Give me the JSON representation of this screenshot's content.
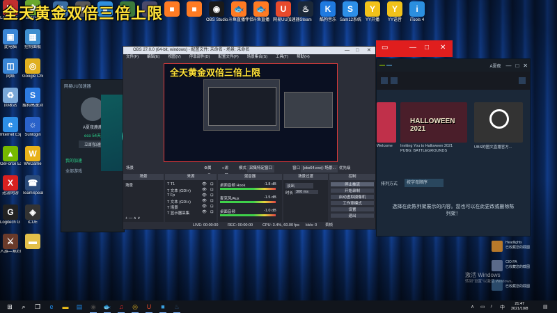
{
  "overlay_title": "全天黄金双倍三倍上限",
  "top_shortcuts": [
    {
      "label": "",
      "icon": "gear-icon",
      "color": "#3a6ea5"
    },
    {
      "label": "",
      "icon": "app-icon",
      "color": "#5a5a5a"
    },
    {
      "label": "",
      "icon": "app-icon",
      "color": "#2f8fdf"
    },
    {
      "label": "",
      "icon": "app-icon",
      "color": "#3b7a3b"
    },
    {
      "label": "",
      "icon": "app-icon",
      "color": "#4a4a6a"
    },
    {
      "label": "",
      "icon": "app-icon",
      "color": "#ff7b23"
    },
    {
      "label": "",
      "icon": "app-icon",
      "color": "#ff7b23"
    },
    {
      "label": "OBS Studio",
      "icon": "obs-icon",
      "color": "#1a1a1a"
    },
    {
      "label": "斗鱼直播伴侣",
      "icon": "douyu-icon",
      "color": "#ff7b23"
    },
    {
      "label": "斗鱼直播",
      "icon": "douyu-icon",
      "color": "#ff7b23"
    },
    {
      "label": "网易UU加速器",
      "icon": "uu-icon",
      "color": "#e84a2c"
    },
    {
      "label": "Steam",
      "icon": "steam-icon",
      "color": "#1b2838"
    },
    {
      "label": "酷狗音乐",
      "icon": "kugou-icon",
      "color": "#1f7ae0"
    },
    {
      "label": "Sam12系统",
      "icon": "s-icon",
      "color": "#2d8fe8"
    },
    {
      "label": "YY开播",
      "icon": "yy-icon",
      "color": "#f2c21a"
    },
    {
      "label": "YY语音",
      "icon": "yy-icon",
      "color": "#f2c21a"
    },
    {
      "label": "iTools 4",
      "icon": "itools-icon",
      "color": "#2b8fe0"
    }
  ],
  "desktop_icons": [
    {
      "label": "Launcher...",
      "icon": "launcher-icon",
      "color": "#c12f2f"
    },
    {
      "label": "PlantsVs...",
      "icon": "plants-icon",
      "color": "#6aa82e"
    },
    {
      "label": "此电脑",
      "icon": "computer-icon",
      "color": "#3a86d6"
    },
    {
      "label": "控制面板",
      "icon": "control-panel-icon",
      "color": "#3f8fcf"
    },
    {
      "label": "网络",
      "icon": "network-icon",
      "color": "#3a86d6"
    },
    {
      "label": "Google Chrome",
      "icon": "chrome-icon",
      "color": "#e0b020"
    },
    {
      "label": "回收站",
      "icon": "recycle-bin-icon",
      "color": "#7aa8d8"
    },
    {
      "label": "搜狗高速浏览器",
      "icon": "sogou-icon",
      "color": "#2d7be0"
    },
    {
      "label": "Internet Explorer",
      "icon": "ie-icon",
      "color": "#2d8fe8"
    },
    {
      "label": "Sunlogin",
      "icon": "sunlogin-icon",
      "color": "#2a62c9"
    },
    {
      "label": "GeForce Experience",
      "icon": "geforce-icon",
      "color": "#76b900"
    },
    {
      "label": "WeGame",
      "icon": "wegame-icon",
      "color": "#e8b21a"
    },
    {
      "label": "迅游网游",
      "icon": "xunyou-icon",
      "color": "#d82020"
    },
    {
      "label": "TeamSpeak",
      "icon": "teamspeak-icon",
      "color": "#2a4a7a"
    },
    {
      "label": "Logitech G HUB",
      "icon": "logitech-icon",
      "color": "#222222"
    },
    {
      "label": "iCUE",
      "icon": "icue-icon",
      "color": "#333333"
    },
    {
      "label": "人族—焦灼的Human Fa...",
      "icon": "game-icon",
      "color": "#6a3a2a"
    },
    {
      "label": "",
      "icon": "folder-icon",
      "color": "#e3c04a"
    }
  ],
  "obs": {
    "title": "OBS 27.0.0 (64-bit, windows) - 配置文件: 未命名 - 场景: 未命名",
    "menu": [
      "文件(F)",
      "编辑(E)",
      "视图(V)",
      "停靠部件(D)",
      "配置文件(P)",
      "场景集合(S)",
      "工具(T)",
      "帮助(H)"
    ],
    "preview_title": "全天黄金双倍三倍上限",
    "toolbar": {
      "scene_label": "场景",
      "props": "属性",
      "filters": "滤镜",
      "mode_label": "模式",
      "mode_value": "采集特定窗口",
      "window_label": "窗口",
      "window_value": "[obs64.exe]: 场景...",
      "priority": "优先级"
    },
    "docks": {
      "scenes": "场景",
      "sources": "来源",
      "mixer": "混音器",
      "transitions": "场景过渡",
      "controls": "控制"
    },
    "scenes": [
      "场景"
    ],
    "sources": [
      "T1",
      "文本 (GDI+)",
      "Fp",
      "文本 (GDI+)",
      "场景",
      "显示器采集"
    ],
    "mixer": [
      {
        "name": "桌面音频 Hook",
        "level": "-1.8 dB"
      },
      {
        "name": "麦克风/Aux",
        "level": "-1.5 dB"
      },
      {
        "name": "桌面音频",
        "level": "-1.0 dB"
      }
    ],
    "transition": {
      "type": "淡出",
      "duration_label": "时长",
      "duration_value": "300 ms"
    },
    "controls": [
      "停止推流",
      "开始录制",
      "启动虚拟摄像机",
      "工作室模式",
      "设置",
      "退出"
    ],
    "status": {
      "live": "LIVE: 00:00:00",
      "rec": "REC: 00:00:00",
      "cpu": "CPU: 3.4%, 60.00 fps",
      "kbps": "kb/s: 0",
      "drop": "丢帧"
    }
  },
  "steam": {
    "user": "A夏夜",
    "shelf": [
      {
        "caption": "Welcome",
        "color": "#c0304a"
      },
      {
        "caption": "Inviting You to Halloween 2021",
        "color": "#4a1e2a",
        "headline": "HALLOWEEN 2021"
      },
      {
        "caption": "PUBG: BATTLEGROUNDS",
        "color": "#333"
      },
      {
        "caption": "UBS的图文直播官方...",
        "color": "#5a6a7a"
      }
    ],
    "sort_label": "排列方式",
    "sort_value": "按字母顺序",
    "empty_text": "选择在此陈列架展示的内容。您也可以在此更改或删除陈列架！"
  },
  "left_panel": {
    "title": "网易UU加速器",
    "username": "A夏夜鹿鹿",
    "menu": [
      "我的加速",
      "全部游戏"
    ],
    "speed": "eco 54天",
    "version": "立即加速"
  },
  "notifications": [
    {
      "name": "Headlights",
      "text": "已收藏您的截图",
      "color": "#b8792a"
    },
    {
      "name": "CIO PA",
      "text": "已收藏您的截图",
      "color": "#5a6a8a"
    },
    {
      "name": "",
      "text": "已收藏您的截图",
      "color": "#2a4a6a"
    }
  ],
  "activate": {
    "line1": "激活 Windows",
    "line2": "转到\"设置\"以激活 Windows。"
  },
  "taskbar": {
    "clock_time": "21:47",
    "clock_date": "2021/10/8",
    "items": [
      {
        "icon": "windows-start-icon",
        "color": "#ffffff"
      },
      {
        "icon": "search-icon",
        "color": "#ffffff"
      },
      {
        "icon": "task-view-icon",
        "color": "#ffffff"
      },
      {
        "icon": "edge-icon",
        "color": "#1e88e5"
      },
      {
        "icon": "explorer-icon",
        "color": "#f2c21a"
      },
      {
        "icon": "store-icon",
        "color": "#1e88e5"
      },
      {
        "icon": "obs-icon",
        "color": "#444444"
      },
      {
        "icon": "douyu-icon",
        "color": "#ff7b23"
      },
      {
        "icon": "netease-music-icon",
        "color": "#e22a2a"
      },
      {
        "icon": "chrome-icon",
        "color": "#e0b020"
      },
      {
        "icon": "uu-icon",
        "color": "#e84a2c"
      },
      {
        "icon": "app-icon",
        "color": "#3aa0e0"
      },
      {
        "icon": "steam-icon",
        "color": "#2b4a6a"
      }
    ]
  }
}
